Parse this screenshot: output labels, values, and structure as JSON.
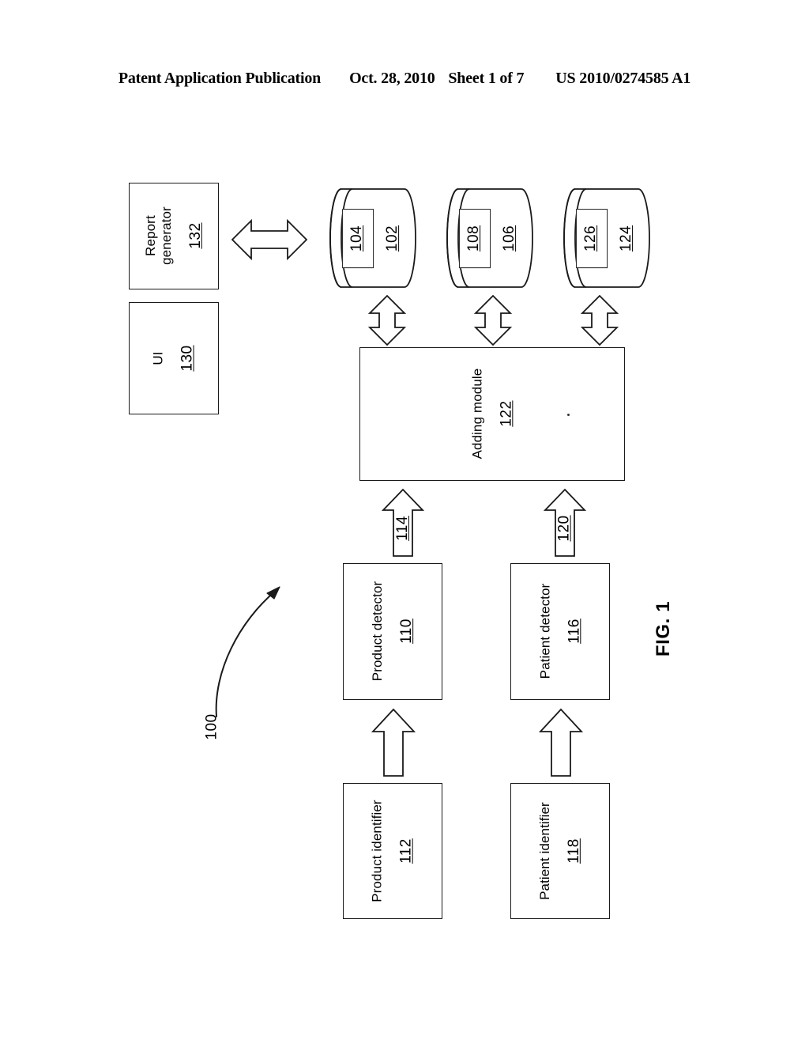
{
  "header": {
    "publication": "Patent Application Publication",
    "date": "Oct. 28, 2010",
    "sheet": "Sheet 1 of 7",
    "patent_number": "US 2010/0274585 A1"
  },
  "figure": {
    "label": "FIG. 1",
    "system_reference": "100"
  },
  "blocks": {
    "report_generator": {
      "label": "Report generator",
      "line1": "Report",
      "line2": "generator",
      "ref": "132"
    },
    "ui": {
      "label": "UI",
      "ref": "130"
    },
    "adding_module": {
      "label": "Adding module",
      "ref": "122"
    },
    "product_detector": {
      "label": "Product detector",
      "ref": "110"
    },
    "patient_detector": {
      "label": "Patient detector",
      "ref": "116"
    },
    "product_identifier": {
      "label": "Product identifier",
      "ref": "112"
    },
    "patient_identifier": {
      "label": "Patient identifier",
      "ref": "118"
    }
  },
  "databases": [
    {
      "outer_ref": "102",
      "inner_ref": "104"
    },
    {
      "outer_ref": "106",
      "inner_ref": "108"
    },
    {
      "outer_ref": "124",
      "inner_ref": "126"
    }
  ],
  "arrows": {
    "report_to_db": {
      "ref": "",
      "type": "double-horizontal"
    },
    "db1_to_adding": {
      "ref": "",
      "type": "double-vertical"
    },
    "db2_to_adding": {
      "ref": "",
      "type": "double-vertical"
    },
    "db3_to_adding": {
      "ref": "",
      "type": "double-vertical"
    },
    "product_to_adding": {
      "ref": "114",
      "type": "single-up"
    },
    "patient_to_adding": {
      "ref": "120",
      "type": "single-up"
    },
    "product_identifier_to_detector": {
      "ref": "",
      "type": "single-up"
    },
    "patient_identifier_to_detector": {
      "ref": "",
      "type": "single-up"
    }
  },
  "colors": {
    "ink": "#1a1a1a",
    "page": "#ffffff"
  }
}
